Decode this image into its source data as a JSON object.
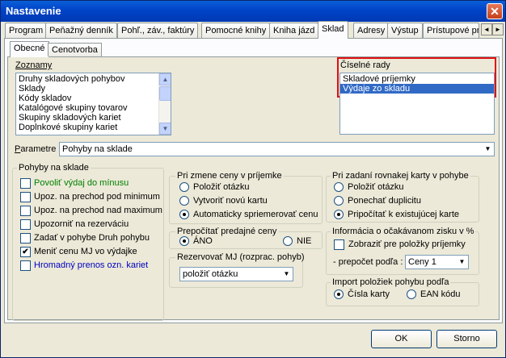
{
  "window": {
    "title": "Nastavenie",
    "close": "✕"
  },
  "tabs": [
    "Program",
    "Peňažný denník",
    "Pohľ., záv., faktúry",
    "Pomocné knihy",
    "Kniha jázd",
    "Sklad",
    "Adresy",
    "Výstup",
    "Prístupové pr"
  ],
  "tab_arrows": {
    "left": "◄",
    "right": "►"
  },
  "subtabs": [
    "Obecné",
    "Cenotvorba"
  ],
  "zoznamy": {
    "label": "Zoznamy",
    "items": [
      "Druhy skladových pohybov",
      "Sklady",
      "Kódy skladov",
      "Katalógové skupiny tovarov",
      "Skupiny skladových kariet",
      "Doplnkové skupiny kariet"
    ],
    "scroll_up": "▲",
    "scroll_down": "▼"
  },
  "ciselne_rady": {
    "label": "Číselné rady",
    "items": [
      "Skladové príjemky",
      "Výdaje zo skladu"
    ]
  },
  "parametre": {
    "label": "Parametre",
    "value": "Pohyby na sklade",
    "drop": "▼"
  },
  "pohyby": {
    "label": "Pohyby na sklade",
    "items": [
      {
        "text": "Povoliť výdaj do mínusu",
        "checked": false,
        "color": "#008000"
      },
      {
        "text": "Upoz. na prechod pod minimum",
        "checked": false,
        "color": "#000000"
      },
      {
        "text": "Upoz. na prechod nad maximum",
        "checked": false,
        "color": "#000000"
      },
      {
        "text": "Upozorniť na rezerváciu",
        "checked": false,
        "color": "#000000"
      },
      {
        "text": "Zadať v pohybe Druh pohybu",
        "checked": false,
        "color": "#000000"
      },
      {
        "text": "Meniť cenu MJ vo výdajke",
        "checked": true,
        "color": "#000000"
      },
      {
        "text": "Hromadný prenos ozn. kariet",
        "checked": false,
        "color": "#0000c0"
      }
    ]
  },
  "zmena_ceny": {
    "label": "Pri zmene ceny v príjemke",
    "options": [
      {
        "text": "Položiť otázku",
        "selected": false
      },
      {
        "text": "Vytvoriť novú kartu",
        "selected": false
      },
      {
        "text": "Automaticky spriemerovať cenu",
        "selected": true
      }
    ]
  },
  "prepocitat": {
    "label": "Prepočítať predajné ceny",
    "options": [
      {
        "text": "ÁNO",
        "selected": true
      },
      {
        "text": "NIE",
        "selected": false
      }
    ]
  },
  "rezervovat": {
    "label": "Rezervovať MJ (rozprac. pohyb)",
    "value": "položiť otázku",
    "drop": "▼"
  },
  "rovnaka_karta": {
    "label": "Pri zadaní rovnakej karty v pohybe",
    "options": [
      {
        "text": "Položiť otázku",
        "selected": false
      },
      {
        "text": "Ponechať duplicitu",
        "selected": false
      },
      {
        "text": "Pripočítať k existujúcej karte",
        "selected": true
      }
    ]
  },
  "zisk": {
    "label": "Informácia o očakávanom zisku v %",
    "checkbox_text": "Zobraziť pre položky príjemky",
    "checked": false,
    "prepocet_label": "- prepočet podľa :",
    "prepocet_value": "Ceny 1",
    "drop": "▼"
  },
  "import": {
    "label": "Import položiek pohybu podľa",
    "options": [
      {
        "text": "Čísla karty",
        "selected": true
      },
      {
        "text": "EAN kódu",
        "selected": false
      }
    ]
  },
  "buttons": {
    "ok": "OK",
    "cancel": "Storno"
  },
  "check_mark": "✔"
}
